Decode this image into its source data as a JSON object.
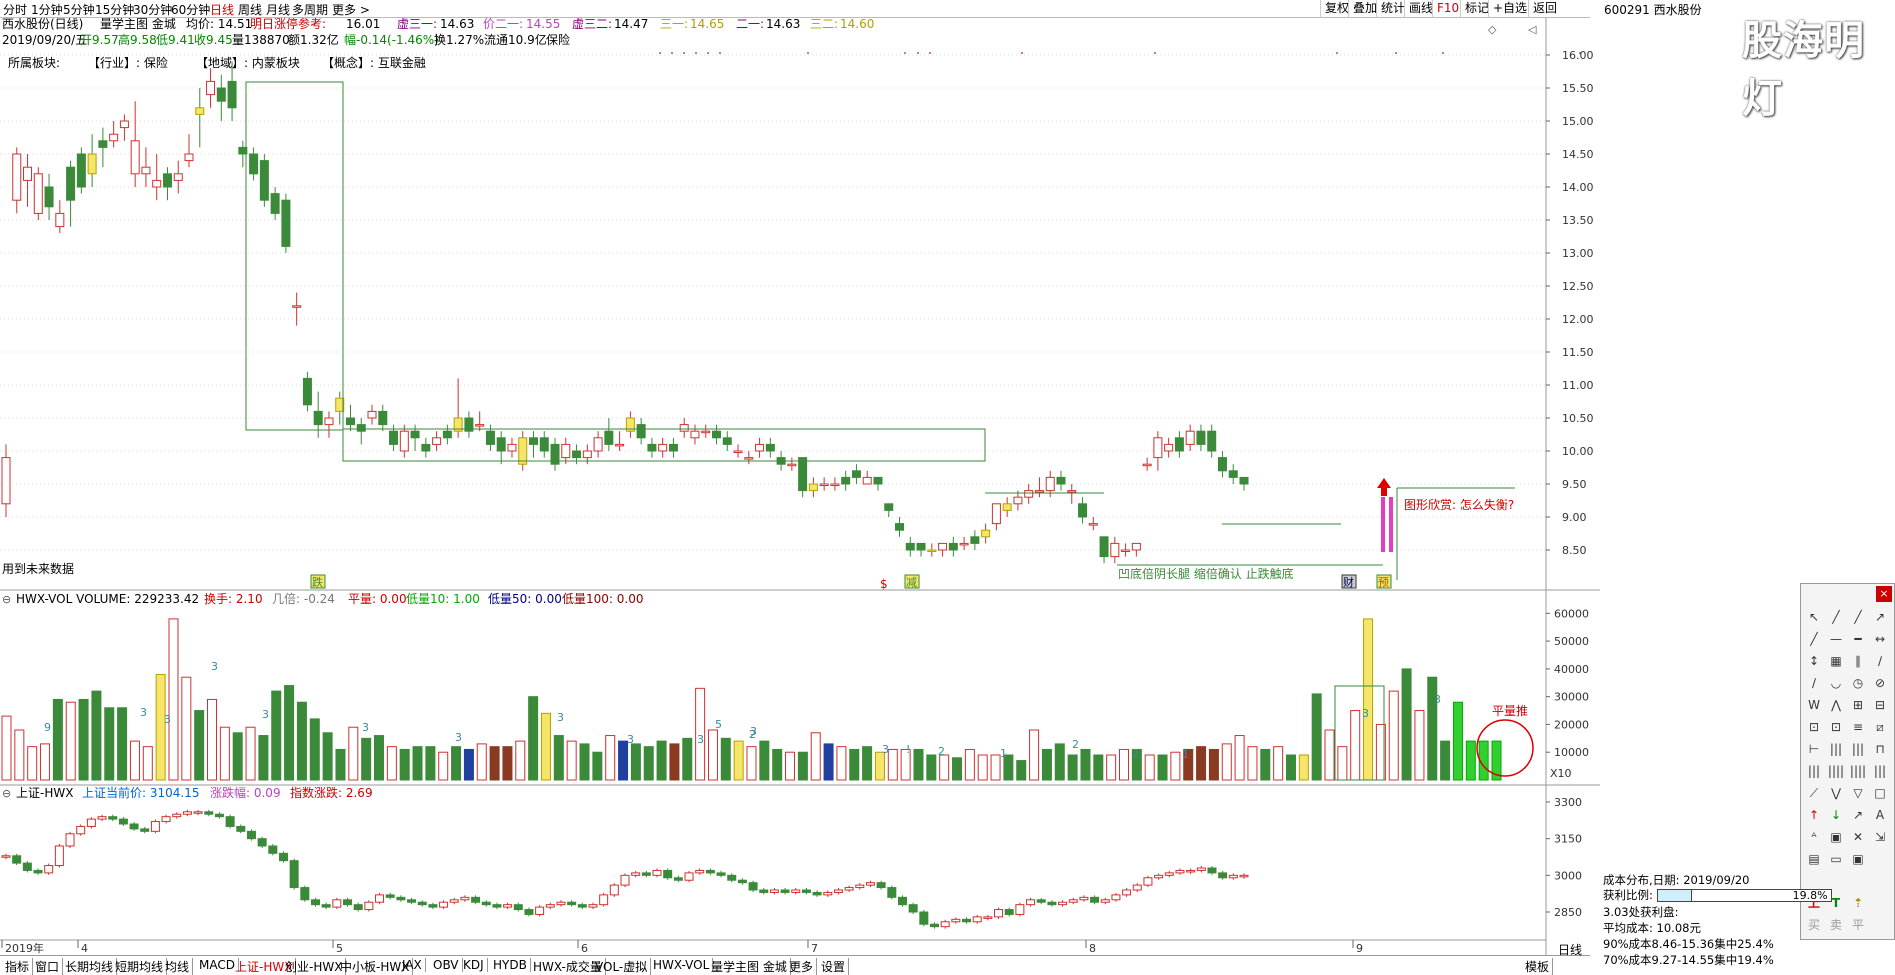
{
  "topbar": {
    "periods": [
      "分时",
      "1分钟",
      "5分钟",
      "15分钟",
      "30分钟",
      "60分钟",
      "日线",
      "周线",
      "月线",
      "多周期",
      "更多 >"
    ],
    "active_index": 6
  },
  "topright": {
    "buttons": [
      "复权",
      "叠加",
      "统计",
      "画线",
      "F10",
      "标记",
      "+自选",
      "返回"
    ]
  },
  "stock": {
    "code": "600291",
    "name": "西水股份"
  },
  "watermark": "股海明灯",
  "header1": {
    "title": "西水股份(日线)",
    "main_indicator": "量学主图 金城",
    "avg": "均价: 14.51",
    "ref_label": "明日涨停参考:",
    "ref_value": "16.01",
    "x1": "虚三一:",
    "x1v": "14.63",
    "x2": "价二一:",
    "x2v": "14.55",
    "x3": "虚三二:",
    "x3v": "14.47",
    "x4": "三一:",
    "x4v": "14.65",
    "x5": "二一:",
    "x5v": "14.63",
    "x6": "三二:",
    "x6v": "14.60"
  },
  "header2": {
    "date": "2019/09/20/五",
    "open": "开9.57",
    "high": "高9.58",
    "low": "低9.41",
    "close": "收9.45",
    "vol": "量138870",
    "amount": "额1.32亿",
    "change": "幅-0.14(-1.46%)",
    "turnover": "换1.27%",
    "float": "流通10.9亿",
    "sector": "保险"
  },
  "sectors": {
    "label": "所属板块:",
    "industry": "【行业】: 保险",
    "region": "【地域】: 内蒙板块",
    "concept": "【概念】: 互联金融"
  },
  "future_data": "用到未来数据",
  "annotations": {
    "a1": "凹底倍阴长腿 缩倍确认 止跌触底",
    "a2": "图形欣赏: 怎么失衡?",
    "a3": "平量推",
    "m1": "跌",
    "m2": "$",
    "m3": "减",
    "m4": "财",
    "m5": "预"
  },
  "price_axis": [
    "16.00",
    "15.50",
    "15.00",
    "14.50",
    "14.00",
    "13.50",
    "13.00",
    "12.50",
    "12.00",
    "11.50",
    "11.00",
    "10.50",
    "10.00",
    "9.50",
    "9.00",
    "8.50"
  ],
  "vol_header": {
    "name": "HWX-VOL VOLUME: 229233.42",
    "hs": "换手: 2.10",
    "jb": "几倍: -0.24",
    "pl": "平量: 0.00",
    "dl10": "低量10: 1.00",
    "dl50": "低量50: 0.00",
    "dl100": "低量100: 0.00"
  },
  "vol_axis": [
    "60000",
    "50000",
    "40000",
    "30000",
    "20000",
    "10000"
  ],
  "vol_unit": "X10",
  "idx_header": {
    "name": "上证-HWX",
    "price": "上证当前价: 3104.15",
    "zdf": "涨跌幅: 0.09",
    "zs": "指数涨跌: 2.69"
  },
  "idx_axis": [
    "3300",
    "3150",
    "3000",
    "2850"
  ],
  "months": [
    "2019年",
    "4",
    "5",
    "6",
    "7",
    "8",
    "9"
  ],
  "bottombar": {
    "tabs": [
      "指标",
      "窗口",
      "长期均线",
      "短期均线",
      "均线",
      "MACD",
      "上证-HWX",
      "创业-HWX",
      "中小板-HWX",
      "JAX",
      "OBV",
      "KDJ",
      "HYDB",
      "HWX-成交量",
      "VOL-虚拟",
      "HWX-VOL",
      "量学主图 金城",
      "更多",
      "设置"
    ],
    "active_index": 6,
    "right_tab": "模板",
    "right_tab2": "日线"
  },
  "cost": {
    "title": "成本分布,日期:",
    "date": "2019/09/20",
    "profit_label": "获利比例:",
    "profit": "19.8%",
    "line2": "3.03处获利盘:",
    "avg": "平均成本: 10.08元",
    "c90": "90%成本8.46-15.36集中25.4%",
    "c70": "70%成本9.27-14.55集中19.4%"
  },
  "toolbox": {
    "trade": [
      "买",
      "卖",
      "平"
    ]
  },
  "colors": {
    "up": "#d03030",
    "down": "#3a8a3a",
    "yellow": "#f0e060",
    "pink": "#e040c0"
  }
}
